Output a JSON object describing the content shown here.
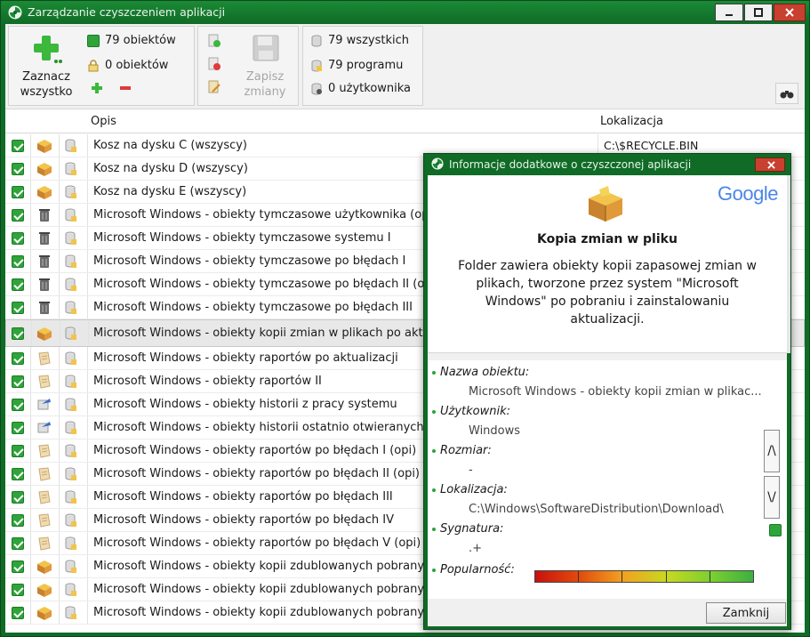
{
  "window": {
    "title": "Zarządzanie czyszczeniem aplikacji"
  },
  "toolbar": {
    "select_all": "Zaznacz wszystko",
    "checked_count": "79 obiektów",
    "locked_count": "0 obiektów",
    "save_changes": "Zapisz zmiany",
    "all_count": "79 wszystkich",
    "program_count": "79 programu",
    "user_count": "0 użytkownika"
  },
  "list": {
    "headers": {
      "description": "Opis",
      "location": "Lokalizacja"
    },
    "rows": [
      {
        "desc": "Kosz na dysku C (wszyscy)",
        "loc": "C:\\$RECYCLE.BIN",
        "icon": "package-icon"
      },
      {
        "desc": "Kosz na dysku D (wszyscy)",
        "loc": "",
        "icon": "package-icon"
      },
      {
        "desc": "Kosz na dysku E (wszyscy)",
        "loc": "",
        "icon": "package-icon"
      },
      {
        "desc": "Microsoft Windows - obiekty tymczasowe użytkownika (op",
        "loc": "",
        "icon": "trash-icon"
      },
      {
        "desc": "Microsoft Windows - obiekty tymczasowe systemu I",
        "loc": "",
        "icon": "trash-icon"
      },
      {
        "desc": "Microsoft Windows - obiekty tymczasowe po błędach I",
        "loc": "",
        "icon": "trash-icon"
      },
      {
        "desc": "Microsoft Windows - obiekty tymczasowe po błędach II (o",
        "loc": "",
        "icon": "trash-icon"
      },
      {
        "desc": "Microsoft Windows - obiekty tymczasowe po błędach III",
        "loc": "",
        "icon": "trash-icon"
      },
      {
        "desc": "Microsoft Windows - obiekty kopii zmian w plikach po akt",
        "loc": "",
        "icon": "package-icon",
        "selected": true
      },
      {
        "desc": "Microsoft Windows - obiekty raportów po aktualizacji",
        "loc": "",
        "icon": "report-icon"
      },
      {
        "desc": "Microsoft Windows - obiekty raportów II",
        "loc": "",
        "icon": "report-icon"
      },
      {
        "desc": "Microsoft Windows - obiekty historii z pracy systemu",
        "loc": "",
        "icon": "history-icon"
      },
      {
        "desc": "Microsoft Windows - obiekty historii ostatnio otwieranych d",
        "loc": "",
        "icon": "history-icon"
      },
      {
        "desc": "Microsoft Windows - obiekty raportów po błędach I (opi)",
        "loc": "",
        "icon": "report-icon"
      },
      {
        "desc": "Microsoft Windows - obiekty raportów po błędach II (opi)",
        "loc": "",
        "icon": "report-icon"
      },
      {
        "desc": "Microsoft Windows - obiekty raportów po błędach III",
        "loc": "",
        "icon": "report-icon"
      },
      {
        "desc": "Microsoft Windows - obiekty raportów po błędach IV",
        "loc": "",
        "icon": "report-icon"
      },
      {
        "desc": "Microsoft Windows - obiekty raportów po błędach V (opi)",
        "loc": "",
        "icon": "report-icon"
      },
      {
        "desc": "Microsoft Windows - obiekty kopii zdublowanych pobrany",
        "loc": "",
        "icon": "package-icon"
      },
      {
        "desc": "Microsoft Windows - obiekty kopii zdublowanych pobrany",
        "loc": "",
        "icon": "package-icon"
      },
      {
        "desc": "Microsoft Windows - obiekty kopii zdublowanych pobrany",
        "loc": "",
        "icon": "package-icon"
      }
    ]
  },
  "popup": {
    "title": "Informacje dodatkowe o czyszczonej aplikacji",
    "google": "Google",
    "heading": "Kopia zmian w pliku",
    "description": "Folder zawiera obiekty kopii zapasowej zmian w plikach, tworzone przez system \"Microsoft Windows\" po pobraniu i zainstalowaniu aktualizacji.",
    "fields": {
      "name_label": "Nazwa obiektu:",
      "name_value": "Microsoft Windows - obiekty kopii zmian w plikac...",
      "user_label": "Użytkownik:",
      "user_value": "Windows",
      "size_label": "Rozmiar:",
      "size_value": "-",
      "location_label": "Lokalizacja:",
      "location_value": "C:\\Windows\\SoftwareDistribution\\Download\\",
      "signature_label": "Sygnatura:",
      "signature_value": ".+",
      "popularity_label": "Popularność:"
    },
    "scroll_up": "/\\",
    "scroll_down": "\\/",
    "close_button": "Zamknij",
    "popularity_colors": [
      "#c8100f",
      "#e24a0c",
      "#f2a020",
      "#c8d820",
      "#7ed030",
      "#3cb040",
      "#20a050"
    ]
  }
}
